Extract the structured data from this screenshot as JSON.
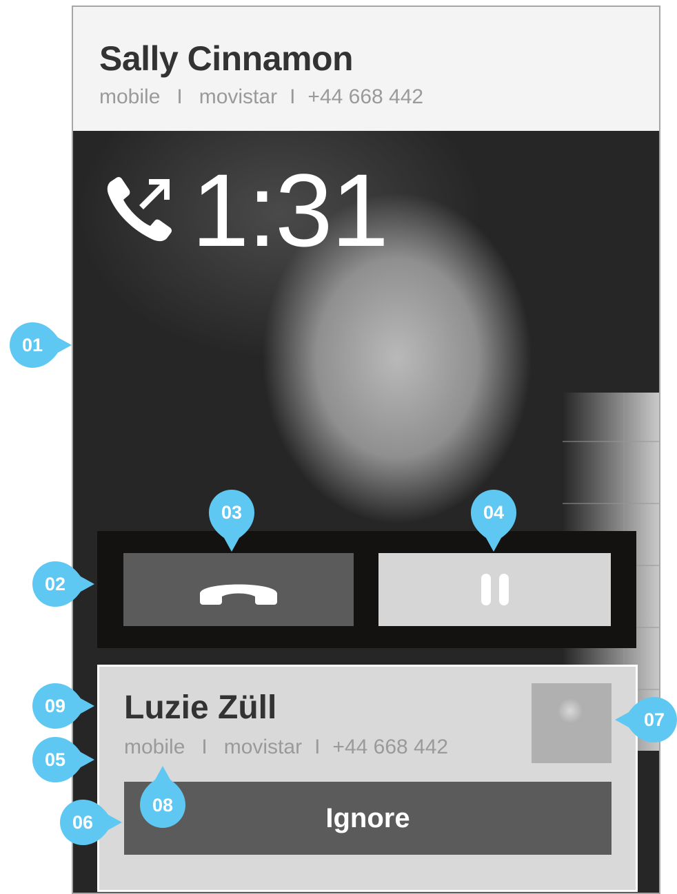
{
  "active_call": {
    "caller_name": "Sally Cinnamon",
    "line_type": "mobile",
    "separator": "I",
    "carrier": "movistar",
    "phone_number": "+44 668 442",
    "duration": "1:31",
    "call_icon": "outgoing-call-icon"
  },
  "controls": {
    "hangup_icon": "hang-up-icon",
    "hold_icon": "pause-icon"
  },
  "incoming_call": {
    "caller_name": "Luzie Züll",
    "line_type": "mobile",
    "separator": "I",
    "carrier": "movistar",
    "phone_number": "+44 668 442",
    "ignore_label": "Ignore"
  },
  "annotations": {
    "m01": "01",
    "m02": "02",
    "m03": "03",
    "m04": "04",
    "m05": "05",
    "m06": "06",
    "m07": "07",
    "m08": "08",
    "m09": "09"
  },
  "colors": {
    "marker": "#5ec8f2",
    "control_bar": "#141210",
    "button_dark": "#5b5b5b",
    "button_light": "#d6d6d6",
    "header_bg": "#f4f4f4",
    "incoming_bg": "#d9d9d9"
  }
}
